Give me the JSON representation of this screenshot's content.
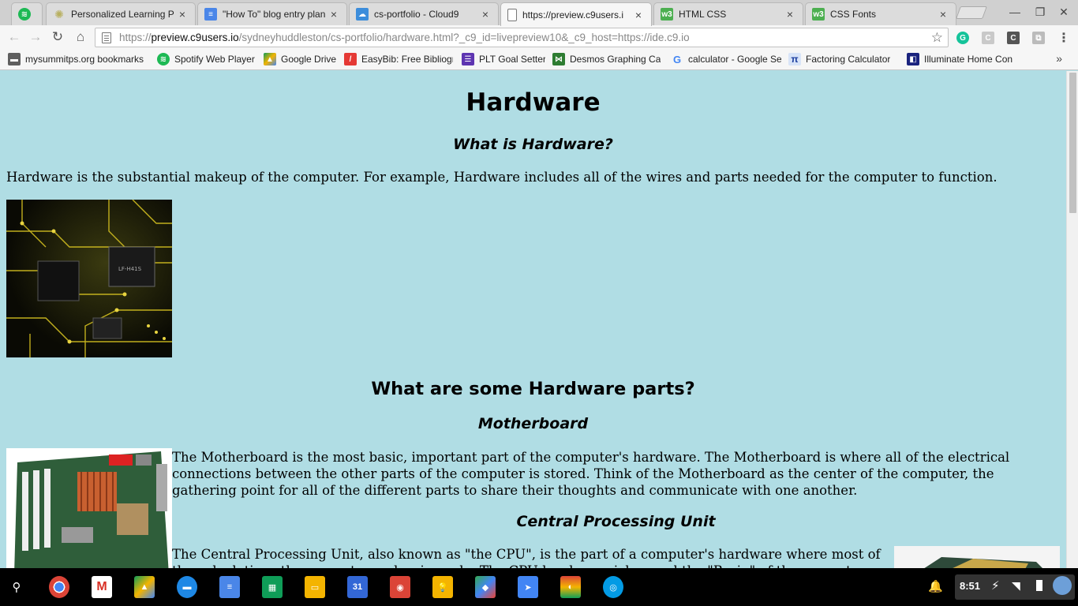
{
  "browser": {
    "tabs": [
      {
        "title": "",
        "favicon": "spotify-icon",
        "active": false
      },
      {
        "title": "Personalized Learning P",
        "favicon": "sun-icon",
        "active": false
      },
      {
        "title": "\"How To\" blog entry plan",
        "favicon": "docs-icon",
        "active": false
      },
      {
        "title": "cs-portfolio - Cloud9",
        "favicon": "cloud9-icon",
        "active": false
      },
      {
        "title": "https://preview.c9users.i",
        "favicon": "page-icon",
        "active": true
      },
      {
        "title": "HTML CSS",
        "favicon": "w3-icon",
        "active": false
      },
      {
        "title": "CSS Fonts",
        "favicon": "w3-icon",
        "active": false
      }
    ],
    "omnibox": {
      "scheme": "https://",
      "host": "preview.c9users.io",
      "path": "/sydneyhuddleston/cs-portfolio/hardware.html?_c9_id=livepreview10&_c9_host=https://ide.c9.io"
    },
    "bookmarks": [
      {
        "label": "mysummitps.org bookmarks",
        "icon": "folder-icon"
      },
      {
        "label": "Spotify Web Player",
        "icon": "spotify-icon"
      },
      {
        "label": "Google Drive",
        "icon": "drive-icon"
      },
      {
        "label": "EasyBib: Free Bibliogr",
        "icon": "easybib-icon"
      },
      {
        "label": "PLT Goal Setter",
        "icon": "grid-icon"
      },
      {
        "label": "Desmos Graphing Ca",
        "icon": "desmos-icon"
      },
      {
        "label": "calculator - Google Se",
        "icon": "google-icon"
      },
      {
        "label": "Factoring Calculator",
        "icon": "pi-icon"
      },
      {
        "label": "Illuminate Home Con",
        "icon": "illuminate-icon"
      }
    ],
    "chevron": "»"
  },
  "page": {
    "title": "Hardware",
    "what_heading": "What is Hardware?",
    "what_text": "Hardware is the substantial makeup of the computer. For example, Hardware includes all of the wires and parts needed for the computer to function.",
    "parts_heading": "What are some Hardware parts?",
    "motherboard_heading": "Motherboard",
    "motherboard_text": "The Motherboard is the most basic, important part of the computer's hardware. The Motherboard is where all of the electrical connections between the other parts of the computer is stored. Think of the Motherboard as the center of the computer, the gathering point for all of the different parts to share their thoughts and communicate with one another.",
    "cpu_heading": "Central Processing Unit",
    "cpu_text": "The Central Processing Unit, also known as \"the CPU\", is the part of a computer's hardware where most of the calculations the computer makes is made. The CPU has been nicknamed the \"Brain\" of the computer, as the CPU"
  },
  "shelf": {
    "clock": "8:51",
    "apps": [
      "search-icon",
      "chrome-icon",
      "gmail-icon",
      "drive-icon",
      "files-icon",
      "docs-icon",
      "sheets-icon",
      "slides-icon",
      "calendar-icon",
      "keep-icon",
      "keep-bulb-icon",
      "maps-icon",
      "send-icon",
      "webstore-icon",
      "camera-icon"
    ],
    "calendar_day": "31"
  },
  "colors": {
    "page_background": "#b0dde4",
    "toolbar": "#f6f6f6",
    "shelf": "#000000"
  }
}
